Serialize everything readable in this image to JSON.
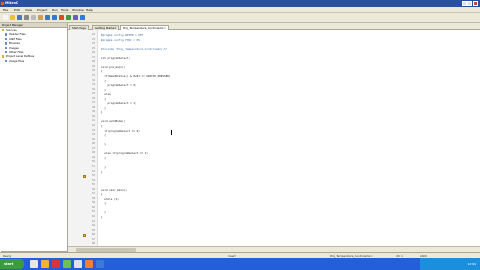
{
  "window": {
    "title": "MikroC",
    "controls": [
      "minimize",
      "maximize",
      "close"
    ]
  },
  "menu": [
    "File",
    "Edit",
    "View",
    "Project",
    "Run",
    "Tools",
    "Window",
    "Help"
  ],
  "toolbar": {
    "icons": [
      "new-file-icon",
      "open-file-icon",
      "save-icon",
      "cut-icon",
      "copy-icon",
      "paste-icon",
      "undo-icon",
      "redo-icon",
      "build-icon",
      "run-icon",
      "debug-icon",
      "help-icon"
    ],
    "colors": [
      "#f5f5f5",
      "#f0c040",
      "#4a74c4",
      "#888888",
      "#bbbbbb",
      "#c9a15a",
      "#2e7bd1",
      "#2e7bd1",
      "#d84a2b",
      "#3c9c3c",
      "#6a5acd",
      "#2a7fd4"
    ]
  },
  "left_panel": {
    "header": "Project Manager",
    "items": [
      {
        "label": "Sources",
        "sub": false
      },
      {
        "label": "Header Files",
        "sub": true
      },
      {
        "label": "ASM Files",
        "sub": true
      },
      {
        "label": "Binaries",
        "sub": true
      },
      {
        "label": "Images",
        "sub": true
      },
      {
        "label": "Other Files",
        "sub": true
      },
      {
        "label": "Project Level Defines",
        "sub": false
      },
      {
        "label": "Image Files",
        "sub": true
      }
    ],
    "tabs": [
      "Project Manager",
      "Code Explorer"
    ]
  },
  "editor_tabs": [
    "Start Page",
    "Getting Started",
    "Proj_Temperatura_Controlador.c"
  ],
  "code_lines": [
    {
      "text": "#pragma config WDTEN = OFF",
      "kind": "pp"
    },
    {
      "text": "#pragma config FOSC = HS",
      "kind": "pp"
    },
    {
      "text": "",
      "kind": "code"
    },
    {
      "text": "#include \"Proj_Temperatura_Controlador.h\"",
      "kind": "pp"
    },
    {
      "text": "",
      "kind": "code"
    },
    {
      "text": "int programSelect;",
      "kind": "code"
    },
    {
      "text": "",
      "kind": "code"
    },
    {
      "text": "void pre_main()",
      "kind": "code"
    },
    {
      "text": "{",
      "kind": "code"
    },
    {
      "text": "  if(ReadStatus() & 0x01 == SWITCH_PRESSED)",
      "kind": "code"
    },
    {
      "text": "  {",
      "kind": "code"
    },
    {
      "text": "    programSelect = 0;",
      "kind": "code"
    },
    {
      "text": "  }",
      "kind": "code"
    },
    {
      "text": "  else",
      "kind": "code"
    },
    {
      "text": "  {",
      "kind": "code"
    },
    {
      "text": "    programSelect = 1;",
      "kind": "code"
    },
    {
      "text": "  }",
      "kind": "code"
    },
    {
      "text": "}",
      "kind": "code"
    },
    {
      "text": "",
      "kind": "code"
    },
    {
      "text": "void autoMode()",
      "kind": "code"
    },
    {
      "text": "{",
      "kind": "code"
    },
    {
      "text": "  if(programSelect == 0)",
      "kind": "code"
    },
    {
      "text": "  {",
      "kind": "code"
    },
    {
      "text": "",
      "kind": "code"
    },
    {
      "text": "  }",
      "kind": "code"
    },
    {
      "text": "",
      "kind": "code"
    },
    {
      "text": "  else if(programSelect == 1)",
      "kind": "code"
    },
    {
      "text": "  {",
      "kind": "code"
    },
    {
      "text": "",
      "kind": "code"
    },
    {
      "text": "  }",
      "kind": "code"
    },
    {
      "text": "}",
      "kind": "code"
    },
    {
      "text": "",
      "kind": "code"
    },
    {
      "text": "",
      "kind": "code"
    },
    {
      "text": "",
      "kind": "code"
    },
    {
      "text": "void user_main()",
      "kind": "code"
    },
    {
      "text": "{",
      "kind": "code"
    },
    {
      "text": "  while (1)",
      "kind": "code"
    },
    {
      "text": "  {",
      "kind": "code"
    },
    {
      "text": "",
      "kind": "code"
    },
    {
      "text": "  }",
      "kind": "code"
    },
    {
      "text": "}",
      "kind": "code"
    },
    {
      "text": "",
      "kind": "code"
    },
    {
      "text": "",
      "kind": "code"
    },
    {
      "text": "",
      "kind": "code"
    },
    {
      "text": "",
      "kind": "code"
    },
    {
      "text": "",
      "kind": "code"
    },
    {
      "text": "",
      "kind": "code"
    }
  ],
  "line_numbers": [
    "22",
    "23",
    "24",
    "25",
    "26",
    "27",
    "28",
    "29",
    "30",
    "31",
    "32",
    "33",
    "34",
    "35",
    "36",
    "37",
    "38",
    "39",
    "40",
    "41",
    "42",
    "43",
    "44",
    "45",
    "46",
    "47",
    "48",
    "49",
    "50",
    "51",
    "52",
    "53",
    "54",
    "55",
    "56",
    "57",
    "58",
    "59",
    "60",
    "61",
    "62",
    "63",
    "64",
    "65",
    "66",
    "67",
    "68"
  ],
  "status": {
    "left": "Ready",
    "mode": "Insert",
    "file": "Proj_Temperatura_Controlador.c",
    "position": "43: 1",
    "encoding": "ASCII"
  },
  "taskbar": {
    "start": "start",
    "clock": "12:09"
  }
}
